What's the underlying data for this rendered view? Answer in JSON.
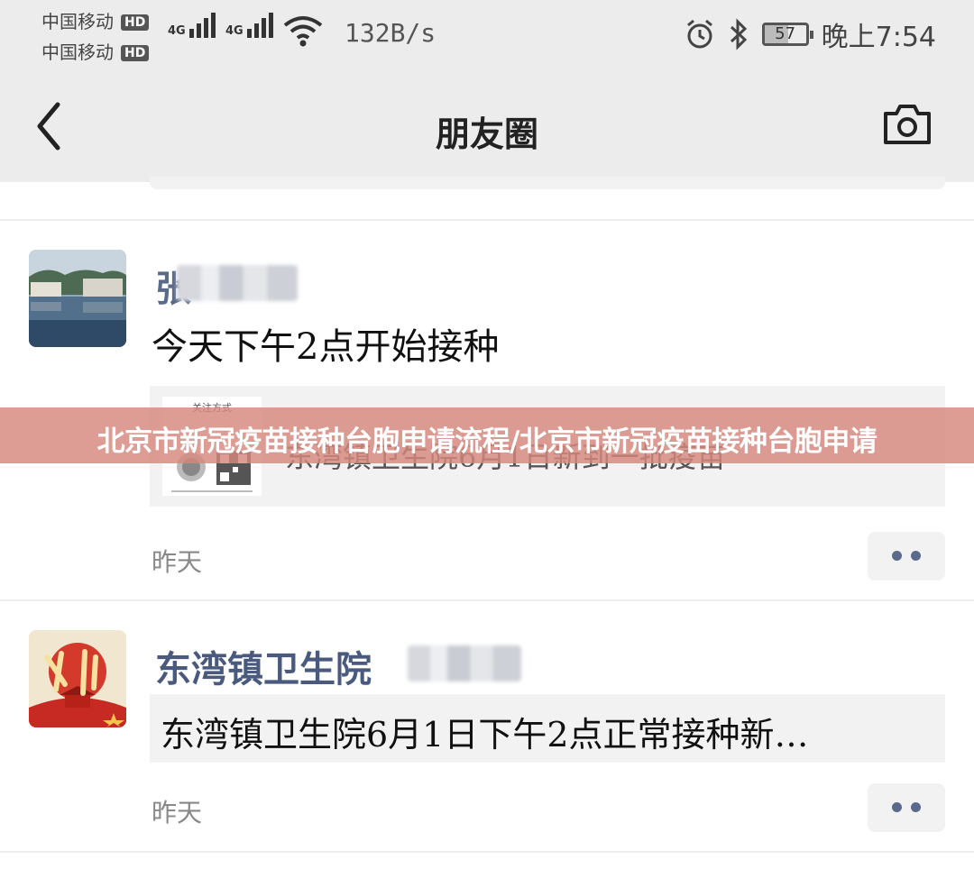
{
  "status_bar": {
    "carrier_1": "中国移动",
    "carrier_2": "中国移动",
    "hd_badge": "HD",
    "signal_label": "4G",
    "network_speed": "132B/s",
    "battery_level": "57",
    "time": "晚上7:54"
  },
  "nav": {
    "title": "朋友圈",
    "back_icon": "chevron-left-icon",
    "camera_icon": "camera-icon"
  },
  "posts": [
    {
      "author": "张",
      "text": "今天下午2点开始接种",
      "shared_card": {
        "thumb_caption": "关注方式",
        "title": "东湾镇卫生院6月1日新到一批疫苗"
      },
      "time": "昨天"
    },
    {
      "author": "东湾镇卫生院",
      "shared_card": {
        "title": "东湾镇卫生院6月1日下午2点正常接种新…"
      },
      "time": "昨天"
    }
  ],
  "banner": {
    "text": "北京市新冠疫苗接种台胞申请流程/北京市新冠疫苗接种台胞申请"
  },
  "colors": {
    "name_link": "#4a5a7e",
    "banner_bg": "#d6877d",
    "nav_bg": "#ececec"
  }
}
